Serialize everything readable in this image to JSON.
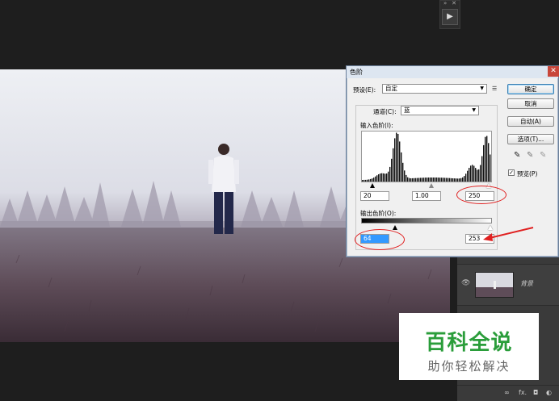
{
  "dialog": {
    "title": "色阶",
    "preset_label": "预设(E):",
    "preset_value": "自定",
    "channel_label": "通道(C):",
    "channel_value": "蓝",
    "input_levels_label": "输入色阶(I):",
    "input_black": "20",
    "input_gamma": "1.00",
    "input_white": "250",
    "output_levels_label": "输出色阶(O):",
    "output_black": "64",
    "output_white": "253",
    "buttons": {
      "ok": "确定",
      "cancel": "取消",
      "auto": "自动(A)",
      "options": "选项(T)..."
    },
    "preview_label": "预览(P)",
    "preview_checked": true,
    "close_glyph": "✕"
  },
  "layers": {
    "layer_name": "背景"
  },
  "watermark": {
    "title": "百科全说",
    "subtitle": "助你轻松解决"
  },
  "colors": {
    "annotation": "#e02020",
    "watermark_green": "#2a9d3a"
  }
}
